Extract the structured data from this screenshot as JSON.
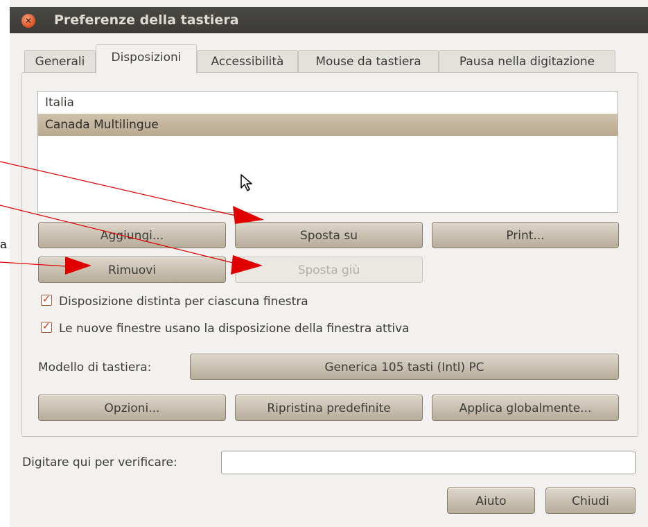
{
  "window": {
    "title": "Preferenze della tastiera",
    "close_icon": "close-icon"
  },
  "tabs": [
    {
      "label": "Generali",
      "active": false
    },
    {
      "label": "Disposizioni",
      "active": true
    },
    {
      "label": "Accessibilità",
      "active": false
    },
    {
      "label": "Mouse da tastiera",
      "active": false
    },
    {
      "label": "Pausa nella digitazione",
      "active": false
    }
  ],
  "layouts_list": [
    {
      "label": "Italia",
      "selected": false
    },
    {
      "label": "Canada Multilingue",
      "selected": true
    }
  ],
  "buttons": {
    "add": "Aggiungi...",
    "move_up": "Sposta su",
    "print": "Print...",
    "remove": "Rimuovi",
    "move_down": "Sposta giù",
    "move_down_disabled": true,
    "options": "Opzioni...",
    "reset_defaults": "Ripristina predefinite",
    "apply_global": "Applica globalmente...",
    "help": "Aiuto",
    "close": "Chiudi"
  },
  "checkboxes": [
    {
      "label": "Disposizione distinta per ciascuna finestra",
      "checked": true
    },
    {
      "label": "Le nuove finestre usano la disposizione della finestra attiva",
      "checked": true
    }
  ],
  "keyboard_model": {
    "label": "Modello di tastiera:",
    "value": "Generica 105 tasti (Intl) PC"
  },
  "test_input": {
    "label": "Digitare qui per verificare:",
    "value": ""
  },
  "annotation": {
    "text_fragment": "a",
    "arrow_color": "#e00000"
  },
  "colors": {
    "titlebar": "#3f3e3a",
    "window_bg": "#f2f1f0",
    "selection": "#c3b59c",
    "accent": "#df5a2a"
  }
}
